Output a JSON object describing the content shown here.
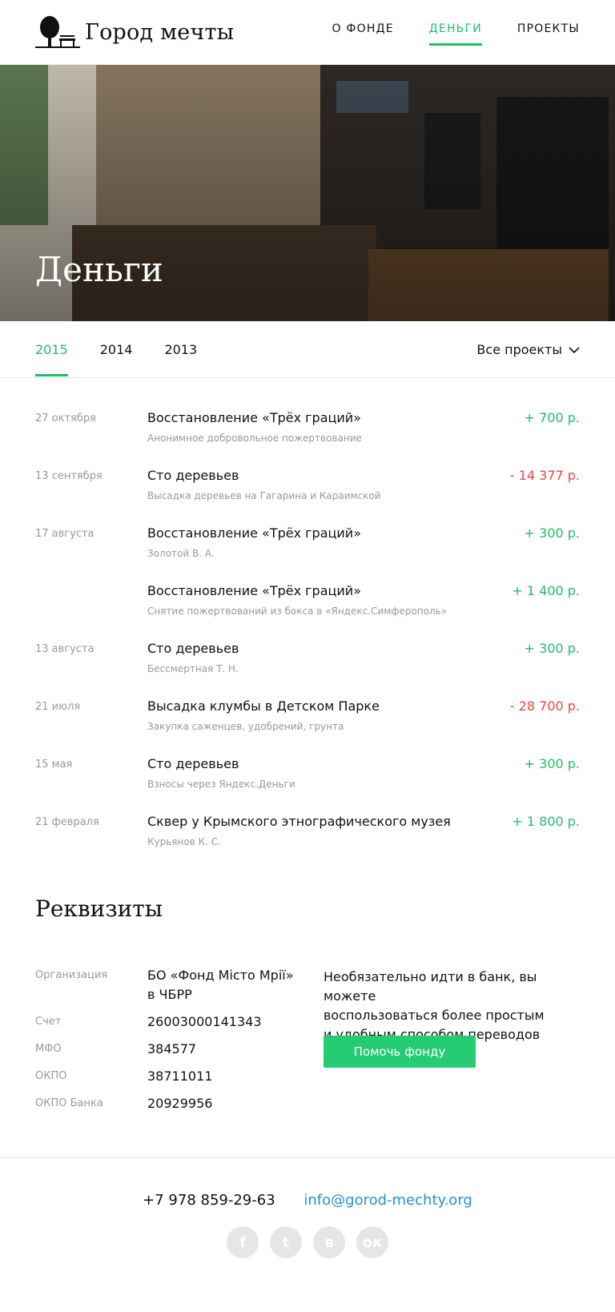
{
  "brand": {
    "name": "Город мечты"
  },
  "nav": [
    {
      "label": "О ФОНДЕ",
      "active": false
    },
    {
      "label": "ДЕНЬГИ",
      "active": true
    },
    {
      "label": "ПРОЕКТЫ",
      "active": false
    }
  ],
  "hero": {
    "title": "Деньги"
  },
  "tabs": {
    "years": [
      {
        "label": "2015",
        "active": true
      },
      {
        "label": "2014",
        "active": false
      },
      {
        "label": "2013",
        "active": false
      }
    ],
    "filter": "Все проекты"
  },
  "transactions": [
    {
      "date": "27 октября",
      "title": "Восстановление «Трёх граций»",
      "subtitle": "Анонимное добровольное пожертвование",
      "amount": "+ 700 р.",
      "type": "pos"
    },
    {
      "date": "13 сентября",
      "title": "Сто деревьев",
      "subtitle": "Высадка деревьев на Гагарина и Караимской",
      "amount": "- 14 377 р.",
      "type": "neg"
    },
    {
      "date": "17 августа",
      "title": "Восстановление «Трёх граций»",
      "subtitle": "Золотой В. А.",
      "amount": "+ 300 р.",
      "type": "pos"
    },
    {
      "date": "",
      "title": "Восстановление «Трёх граций»",
      "subtitle": "Снятие пожертвований из бокса в «Яндекс.Симферополь»",
      "amount": "+ 1 400 р.",
      "type": "pos"
    },
    {
      "date": "13 августа",
      "title": "Сто деревьев",
      "subtitle": "Бессмертная Т. Н.",
      "amount": "+ 300 р.",
      "type": "pos"
    },
    {
      "date": "21 июля",
      "title": "Высадка клумбы в Детском Парке",
      "subtitle": "Закупка саженцев, удобрений, грунта",
      "amount": "- 28 700 р.",
      "type": "neg"
    },
    {
      "date": "15 мая",
      "title": "Сто деревьев",
      "subtitle": "Взносы через Яндекс.Деньги",
      "amount": "+ 300 р.",
      "type": "pos"
    },
    {
      "date": "21 февраля",
      "title": "Сквер у Крымского этнографического музея",
      "subtitle": "Курьянов К. С.",
      "amount": "+ 1 800 р.",
      "type": "pos"
    }
  ],
  "requisites": {
    "title": "Реквизиты",
    "org_label": "Организация",
    "org_line1": "БО «Фонд Місто Мрії»",
    "org_line2": "в ЧБРР",
    "account_label": "Счет",
    "account": "26003000141343",
    "mfo_label": "МФО",
    "mfo": "384577",
    "okpo_label": "ОКПО",
    "okpo": "38711011",
    "okpo_bank_label": "ОКПО Банка",
    "okpo_bank": "20929956",
    "note_line1": "Необязательно идти в банк, вы можете",
    "note_line2": "воспользоваться более простым",
    "note_line3": "и удобным способом переводов",
    "button": "Помочь фонду"
  },
  "footer": {
    "phone": "+7 978 859-29-63",
    "email": "info@gorod-mechty.org",
    "socials": [
      {
        "icon": "facebook-icon",
        "glyph": "f"
      },
      {
        "icon": "twitter-icon",
        "glyph": "t"
      },
      {
        "icon": "vk-icon",
        "glyph": "в"
      },
      {
        "icon": "odnoklassniki-icon",
        "glyph": "ок"
      }
    ]
  },
  "colors": {
    "accent": "#1fbf6a",
    "negative": "#f04343",
    "link": "#2a8fd6",
    "button": "#25cc74"
  }
}
